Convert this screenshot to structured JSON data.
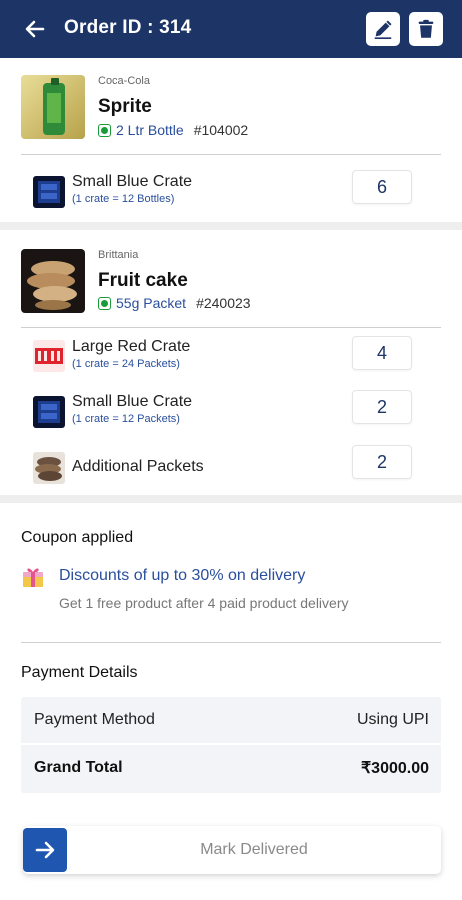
{
  "header": {
    "title": "Order ID : 314",
    "back_icon": "arrow-left-icon",
    "edit_icon": "edit-pen-icon",
    "delete_icon": "trash-icon",
    "bg_color": "#1c3466"
  },
  "products": [
    {
      "brand": "Coca-Cola",
      "name": "Sprite",
      "variant": "2 Ltr Bottle",
      "code": "#104002",
      "crates": [
        {
          "name": "Small Blue Crate",
          "sub": "(1 crate = 12 Bottles)",
          "qty": "6",
          "icon": "blue-crate-icon"
        }
      ]
    },
    {
      "brand": "Brittania",
      "name": "Fruit cake",
      "variant": "55g Packet",
      "code": "#240023",
      "crates": [
        {
          "name": "Large Red Crate",
          "sub": "(1 crate = 24 Packets)",
          "qty": "4",
          "icon": "red-crate-icon"
        },
        {
          "name": "Small Blue Crate",
          "sub": "(1 crate = 12 Packets)",
          "qty": "2",
          "icon": "blue-crate-icon"
        },
        {
          "name": "Additional Packets",
          "sub": "",
          "qty": "2",
          "icon": "packet-icon"
        }
      ]
    }
  ],
  "coupon": {
    "title": "Coupon applied",
    "headline": "Discounts of up to 30% on delivery",
    "description": "Get 1 free product after 4 paid product delivery"
  },
  "payment": {
    "title": "Payment Details",
    "method_label": "Payment Method",
    "method_value": "Using UPI",
    "total_label": "Grand Total",
    "total_value": "₹3000.00"
  },
  "action": {
    "label": "Mark Delivered",
    "accent": "#1f56b0"
  }
}
